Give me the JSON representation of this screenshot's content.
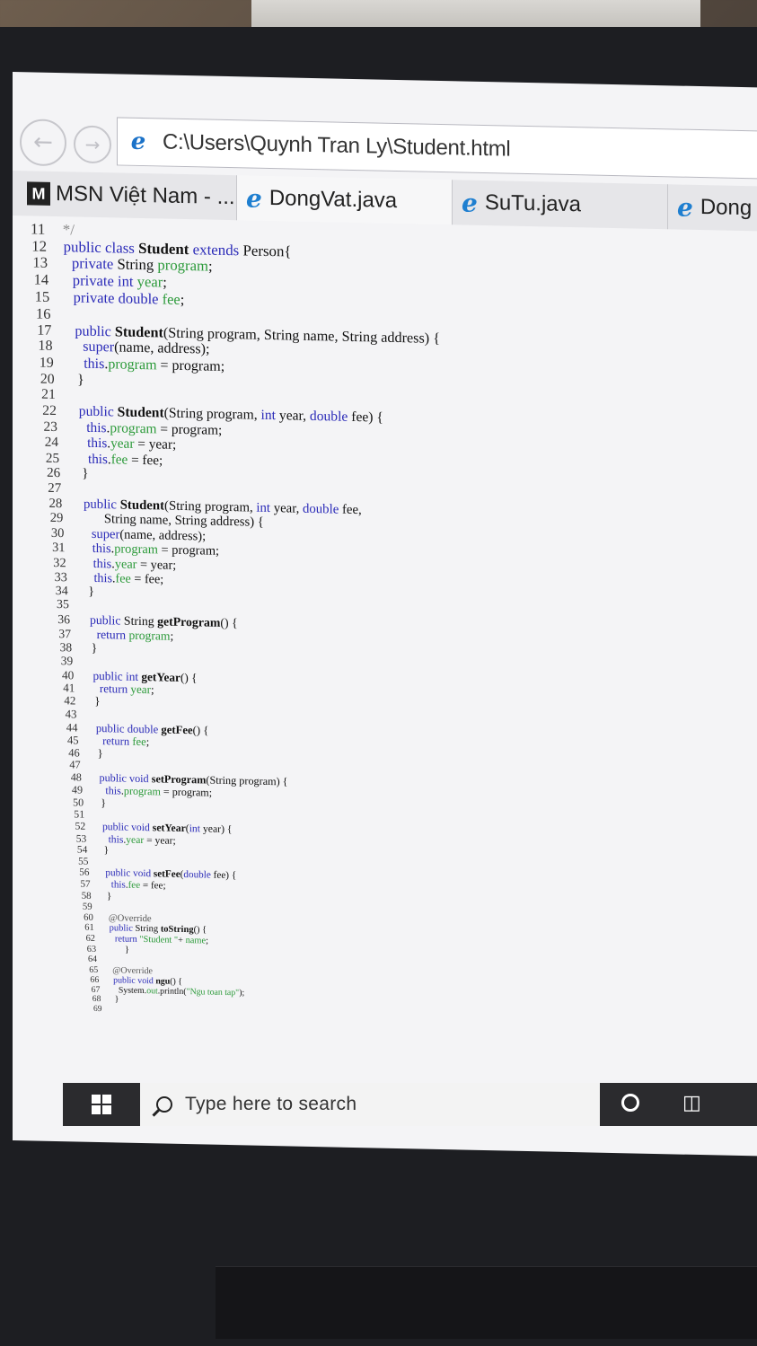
{
  "browser": {
    "address": "C:\\Users\\Quynh Tran Ly\\Student.html",
    "tabs": [
      {
        "label": "MSN Việt Nam - ...",
        "icon": "msn-icon"
      },
      {
        "label": "DongVat.java",
        "icon": "ie-icon"
      },
      {
        "label": "SuTu.java",
        "icon": "ie-icon"
      },
      {
        "label": "Dong",
        "icon": "ie-icon"
      }
    ]
  },
  "code_lines": [
    {
      "n": "11",
      "segs": [
        [
          "c",
          "*/"
        ]
      ]
    },
    {
      "n": "12",
      "segs": [
        [
          "k",
          "public class "
        ],
        [
          "b",
          "Student"
        ],
        [
          "k",
          " extends "
        ],
        [
          "t",
          "Person{"
        ]
      ]
    },
    {
      "n": "13",
      "segs": [
        [
          "t",
          "  "
        ],
        [
          "k",
          "private "
        ],
        [
          "t",
          "String "
        ],
        [
          "f",
          "program"
        ],
        [
          "t",
          ";"
        ]
      ]
    },
    {
      "n": "14",
      "segs": [
        [
          "t",
          "  "
        ],
        [
          "k",
          "private int "
        ],
        [
          "f",
          "year"
        ],
        [
          "t",
          ";"
        ]
      ]
    },
    {
      "n": "15",
      "segs": [
        [
          "t",
          "  "
        ],
        [
          "k",
          "private double "
        ],
        [
          "f",
          "fee"
        ],
        [
          "t",
          ";"
        ]
      ]
    },
    {
      "n": "16",
      "segs": []
    },
    {
      "n": "17",
      "segs": [
        [
          "t",
          "  "
        ],
        [
          "k",
          "public "
        ],
        [
          "b",
          "Student"
        ],
        [
          "t",
          "(String program, String name, String address) {"
        ]
      ]
    },
    {
      "n": "18",
      "segs": [
        [
          "t",
          "    "
        ],
        [
          "k",
          "super"
        ],
        [
          "t",
          "(name, address);"
        ]
      ]
    },
    {
      "n": "19",
      "segs": [
        [
          "t",
          "    "
        ],
        [
          "k",
          "this"
        ],
        [
          "t",
          "."
        ],
        [
          "f",
          "program"
        ],
        [
          "t",
          " = program;"
        ]
      ]
    },
    {
      "n": "20",
      "segs": [
        [
          "t",
          "  }"
        ]
      ]
    },
    {
      "n": "21",
      "segs": []
    },
    {
      "n": "22",
      "segs": [
        [
          "t",
          "  "
        ],
        [
          "k",
          "public "
        ],
        [
          "b",
          "Student"
        ],
        [
          "t",
          "(String program, "
        ],
        [
          "k",
          "int "
        ],
        [
          "t",
          "year, "
        ],
        [
          "k",
          "double "
        ],
        [
          "t",
          "fee) {"
        ]
      ]
    },
    {
      "n": "23",
      "segs": [
        [
          "t",
          "    "
        ],
        [
          "k",
          "this"
        ],
        [
          "t",
          "."
        ],
        [
          "f",
          "program"
        ],
        [
          "t",
          " = program;"
        ]
      ]
    },
    {
      "n": "24",
      "segs": [
        [
          "t",
          "    "
        ],
        [
          "k",
          "this"
        ],
        [
          "t",
          "."
        ],
        [
          "f",
          "year"
        ],
        [
          "t",
          " = year;"
        ]
      ]
    },
    {
      "n": "25",
      "segs": [
        [
          "t",
          "    "
        ],
        [
          "k",
          "this"
        ],
        [
          "t",
          "."
        ],
        [
          "f",
          "fee"
        ],
        [
          "t",
          " = fee;"
        ]
      ]
    },
    {
      "n": "26",
      "segs": [
        [
          "t",
          "  }"
        ]
      ]
    },
    {
      "n": "27",
      "segs": []
    },
    {
      "n": "28",
      "segs": [
        [
          "t",
          "  "
        ],
        [
          "k",
          "public "
        ],
        [
          "b",
          "Student"
        ],
        [
          "t",
          "(String program, "
        ],
        [
          "k",
          "int "
        ],
        [
          "t",
          "year, "
        ],
        [
          "k",
          "double "
        ],
        [
          "t",
          "fee,"
        ]
      ]
    },
    {
      "n": "29",
      "segs": [
        [
          "t",
          "        String name, String address) {"
        ]
      ]
    },
    {
      "n": "30",
      "segs": [
        [
          "t",
          "    "
        ],
        [
          "k",
          "super"
        ],
        [
          "t",
          "(name, address);"
        ]
      ]
    },
    {
      "n": "31",
      "segs": [
        [
          "t",
          "    "
        ],
        [
          "k",
          "this"
        ],
        [
          "t",
          "."
        ],
        [
          "f",
          "program"
        ],
        [
          "t",
          " = program;"
        ]
      ]
    },
    {
      "n": "32",
      "segs": [
        [
          "t",
          "    "
        ],
        [
          "k",
          "this"
        ],
        [
          "t",
          "."
        ],
        [
          "f",
          "year"
        ],
        [
          "t",
          " = year;"
        ]
      ]
    },
    {
      "n": "33",
      "segs": [
        [
          "t",
          "    "
        ],
        [
          "k",
          "this"
        ],
        [
          "t",
          "."
        ],
        [
          "f",
          "fee"
        ],
        [
          "t",
          " = fee;"
        ]
      ]
    },
    {
      "n": "34",
      "segs": [
        [
          "t",
          "  }"
        ]
      ]
    },
    {
      "n": "35",
      "segs": []
    },
    {
      "n": "36",
      "segs": [
        [
          "t",
          "  "
        ],
        [
          "k",
          "public "
        ],
        [
          "t",
          "String "
        ],
        [
          "b",
          "getProgram"
        ],
        [
          "t",
          "() {"
        ]
      ]
    },
    {
      "n": "37",
      "segs": [
        [
          "t",
          "    "
        ],
        [
          "k",
          "return "
        ],
        [
          "f",
          "program"
        ],
        [
          "t",
          ";"
        ]
      ]
    },
    {
      "n": "38",
      "segs": [
        [
          "t",
          "  }"
        ]
      ]
    },
    {
      "n": "39",
      "segs": []
    },
    {
      "n": "40",
      "segs": [
        [
          "t",
          "  "
        ],
        [
          "k",
          "public int "
        ],
        [
          "b",
          "getYear"
        ],
        [
          "t",
          "() {"
        ]
      ]
    },
    {
      "n": "41",
      "segs": [
        [
          "t",
          "    "
        ],
        [
          "k",
          "return "
        ],
        [
          "f",
          "year"
        ],
        [
          "t",
          ";"
        ]
      ]
    },
    {
      "n": "42",
      "segs": [
        [
          "t",
          "  }"
        ]
      ]
    },
    {
      "n": "43",
      "segs": []
    },
    {
      "n": "44",
      "segs": [
        [
          "t",
          "  "
        ],
        [
          "k",
          "public double "
        ],
        [
          "b",
          "getFee"
        ],
        [
          "t",
          "() {"
        ]
      ]
    },
    {
      "n": "45",
      "segs": [
        [
          "t",
          "    "
        ],
        [
          "k",
          "return "
        ],
        [
          "f",
          "fee"
        ],
        [
          "t",
          ";"
        ]
      ]
    },
    {
      "n": "46",
      "segs": [
        [
          "t",
          "  }"
        ]
      ]
    },
    {
      "n": "47",
      "segs": []
    },
    {
      "n": "48",
      "segs": [
        [
          "t",
          "  "
        ],
        [
          "k",
          "public void "
        ],
        [
          "b",
          "setProgram"
        ],
        [
          "t",
          "(String program) {"
        ]
      ]
    },
    {
      "n": "49",
      "segs": [
        [
          "t",
          "    "
        ],
        [
          "k",
          "this"
        ],
        [
          "t",
          "."
        ],
        [
          "f",
          "program"
        ],
        [
          "t",
          " = program;"
        ]
      ]
    },
    {
      "n": "50",
      "segs": [
        [
          "t",
          "  }"
        ]
      ]
    },
    {
      "n": "51",
      "segs": []
    },
    {
      "n": "52",
      "segs": [
        [
          "t",
          "  "
        ],
        [
          "k",
          "public void "
        ],
        [
          "b",
          "setYear"
        ],
        [
          "t",
          "("
        ],
        [
          "k",
          "int "
        ],
        [
          "t",
          "year) {"
        ]
      ]
    },
    {
      "n": "53",
      "segs": [
        [
          "t",
          "    "
        ],
        [
          "k",
          "this"
        ],
        [
          "t",
          "."
        ],
        [
          "f",
          "year"
        ],
        [
          "t",
          " = year;"
        ]
      ]
    },
    {
      "n": "54",
      "segs": [
        [
          "t",
          "  }"
        ]
      ]
    },
    {
      "n": "55",
      "segs": []
    },
    {
      "n": "56",
      "segs": [
        [
          "t",
          "  "
        ],
        [
          "k",
          "public void "
        ],
        [
          "b",
          "setFee"
        ],
        [
          "t",
          "("
        ],
        [
          "k",
          "double "
        ],
        [
          "t",
          "fee) {"
        ]
      ]
    },
    {
      "n": "57",
      "segs": [
        [
          "t",
          "    "
        ],
        [
          "k",
          "this"
        ],
        [
          "t",
          "."
        ],
        [
          "f",
          "fee"
        ],
        [
          "t",
          " = fee;"
        ]
      ]
    },
    {
      "n": "58",
      "segs": [
        [
          "t",
          "  }"
        ]
      ]
    },
    {
      "n": "59",
      "segs": []
    },
    {
      "n": "60",
      "segs": [
        [
          "t",
          "  "
        ],
        [
          "a",
          "@Override"
        ]
      ]
    },
    {
      "n": "61",
      "segs": [
        [
          "t",
          "  "
        ],
        [
          "k",
          "public "
        ],
        [
          "t",
          "String "
        ],
        [
          "b",
          "toString"
        ],
        [
          "t",
          "() {"
        ]
      ]
    },
    {
      "n": "62",
      "segs": [
        [
          "t",
          "    "
        ],
        [
          "k",
          "return "
        ],
        [
          "s",
          "\"Student \""
        ],
        [
          "t",
          "+ "
        ],
        [
          "f",
          "name"
        ],
        [
          "t",
          ";"
        ]
      ]
    },
    {
      "n": "63",
      "segs": [
        [
          "t",
          "        }"
        ]
      ]
    },
    {
      "n": "64",
      "segs": []
    },
    {
      "n": "65",
      "segs": [
        [
          "t",
          "  "
        ],
        [
          "a",
          "@Override"
        ]
      ]
    },
    {
      "n": "66",
      "segs": [
        [
          "t",
          "  "
        ],
        [
          "k",
          "public void "
        ],
        [
          "b",
          "ngu"
        ],
        [
          "t",
          "() {"
        ]
      ]
    },
    {
      "n": "67",
      "segs": [
        [
          "t",
          "    System."
        ],
        [
          "f",
          "out"
        ],
        [
          "t",
          ".println("
        ],
        [
          "s",
          "\"Ngu toan tap\""
        ],
        [
          "t",
          ");"
        ]
      ]
    },
    {
      "n": "68",
      "segs": [
        [
          "t",
          "  }"
        ]
      ]
    },
    {
      "n": "69",
      "segs": []
    }
  ],
  "taskbar": {
    "search_placeholder": "Type here to search"
  },
  "colors": {
    "keyword": "#2b2bb8",
    "field": "#2c9a3a",
    "comment": "#8a8a8a"
  }
}
